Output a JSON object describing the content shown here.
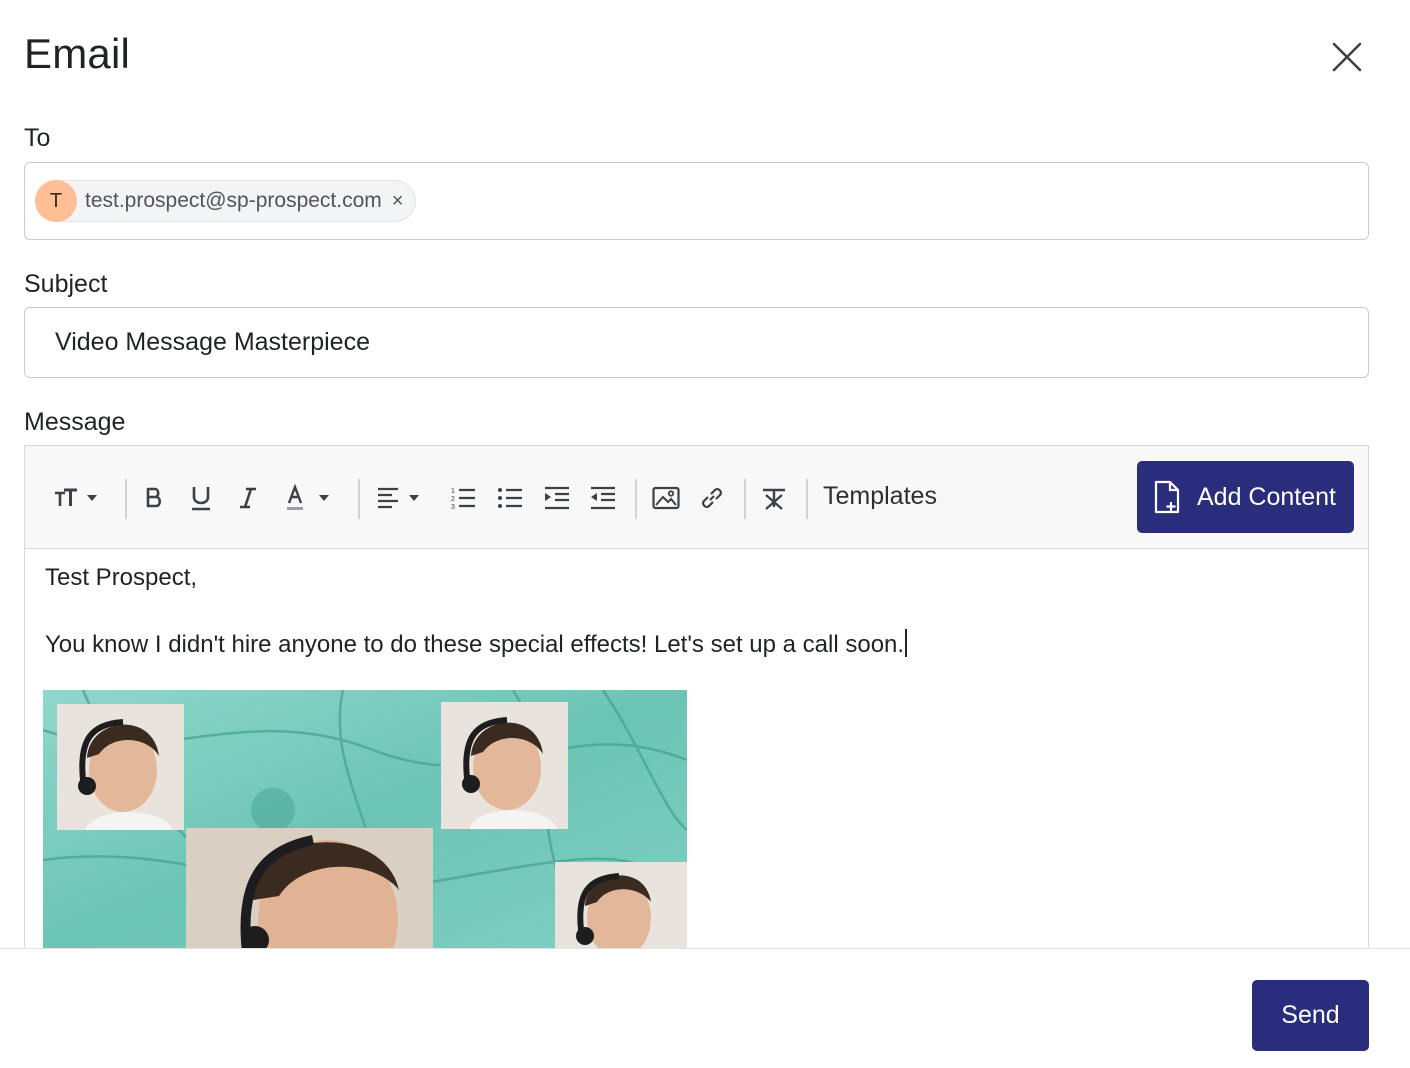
{
  "dialog": {
    "title": "Email",
    "close_icon": "close-icon"
  },
  "to": {
    "label": "To",
    "recipients": [
      {
        "initial": "T",
        "email": "test.prospect@sp-prospect.com",
        "remove": "×",
        "avatar_color": "#ffbe94"
      }
    ]
  },
  "subject": {
    "label": "Subject",
    "value": "Video Message Masterpiece"
  },
  "message": {
    "label": "Message",
    "toolbar": {
      "items": [
        "font-size-icon",
        "bold-icon",
        "underline-icon",
        "italic-icon",
        "text-color-icon",
        "align-icon",
        "ordered-list-icon",
        "bullet-list-icon",
        "indent-icon",
        "outdent-icon",
        "image-icon",
        "link-icon",
        "clear-format-icon"
      ],
      "templates_label": "Templates",
      "add_content_label": "Add Content"
    },
    "body": {
      "greeting": "Test Prospect,",
      "paragraph": "You know I didn't hire anyone to do these special effects! Let's set up a call soon."
    },
    "attachment": "video-thumbnail-image"
  },
  "footer": {
    "send_label": "Send"
  },
  "colors": {
    "primary": "#2a2d7c",
    "avatar": "#ffbe94",
    "thumbnail_bg": "#7ccfc1"
  }
}
